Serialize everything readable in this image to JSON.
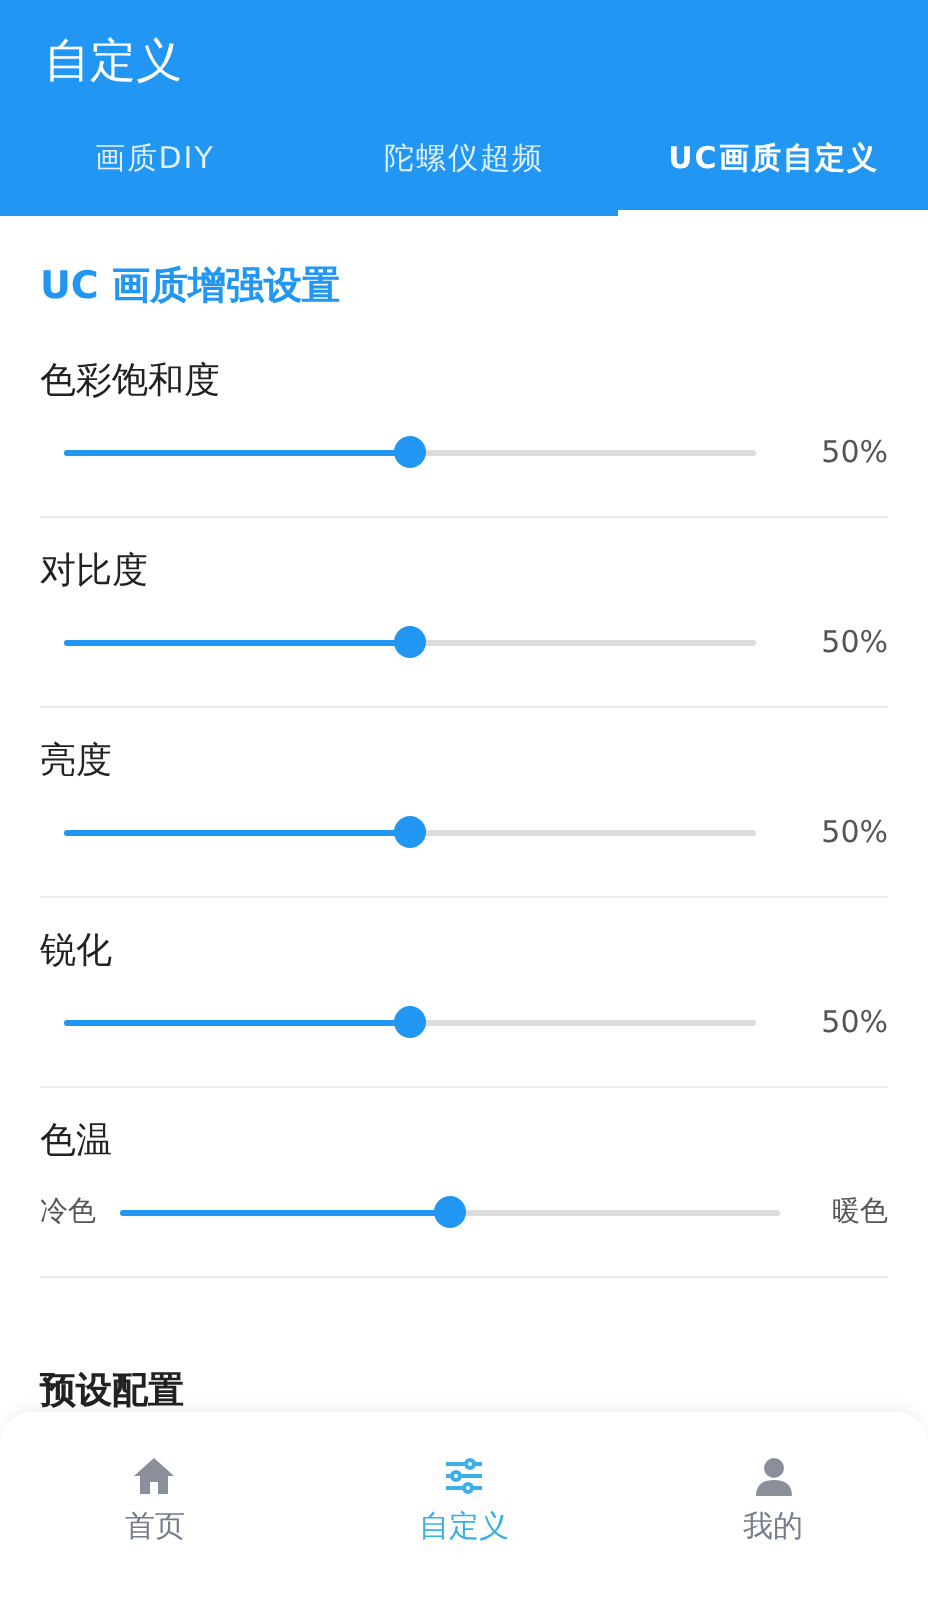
{
  "header": {
    "title": "自定义"
  },
  "tabs": [
    {
      "label": "画质DIY",
      "selected": false
    },
    {
      "label": "陀螺仪超频",
      "selected": false
    },
    {
      "label": "UC画质自定义",
      "selected": true
    }
  ],
  "section": {
    "title": "UC 画质增强设置"
  },
  "settings": [
    {
      "kind": "percent",
      "label": "色彩饱和度",
      "level": 0.5,
      "reading": "50%"
    },
    {
      "kind": "percent",
      "label": "对比度",
      "level": 0.5,
      "reading": "50%"
    },
    {
      "kind": "percent",
      "label": "亮度",
      "level": 0.5,
      "reading": "50%"
    },
    {
      "kind": "percent",
      "label": "锐化",
      "level": 0.5,
      "reading": "50%"
    },
    {
      "kind": "range",
      "label": "色温",
      "level": 0.5,
      "min_label": "冷色",
      "max_label": "暖色"
    }
  ],
  "presets": {
    "title": "预设配置"
  },
  "nav": [
    {
      "kind": "home",
      "label": "首页",
      "selected": false
    },
    {
      "kind": "sliders",
      "label": "自定义",
      "selected": true
    },
    {
      "kind": "person",
      "label": "我的",
      "selected": false
    }
  ]
}
